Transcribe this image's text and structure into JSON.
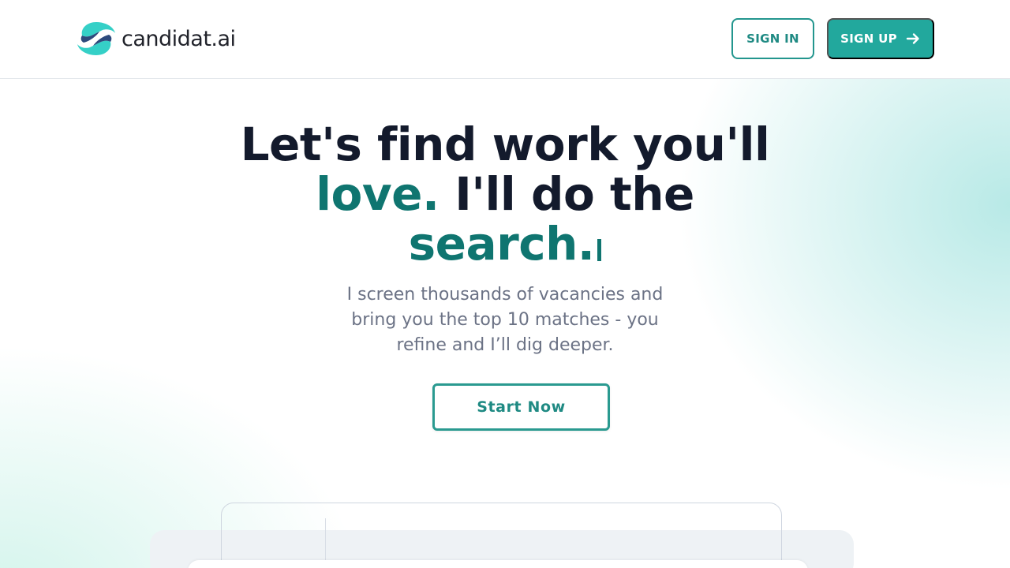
{
  "brand": {
    "name": "candidat.ai",
    "colors": {
      "primary": "#22a89d",
      "accent_text": "#0f7570",
      "dark": "#131a2c",
      "logo_teal": "#35d0c7",
      "logo_navy": "#2d4a7c"
    }
  },
  "header": {
    "sign_in_label": "SIGN IN",
    "sign_up_label": "SIGN UP",
    "sign_up_icon": "arrow-right-icon"
  },
  "hero": {
    "headline_part1": "Let's find work you'll",
    "headline_accent1": "love.",
    "headline_part2": " I'll do the",
    "headline_accent2": "search.",
    "subtitle": "I screen thousands of vacancies and bring you the top 10 matches - you refine and I’ll dig deeper.",
    "cta_label": "Start Now"
  }
}
